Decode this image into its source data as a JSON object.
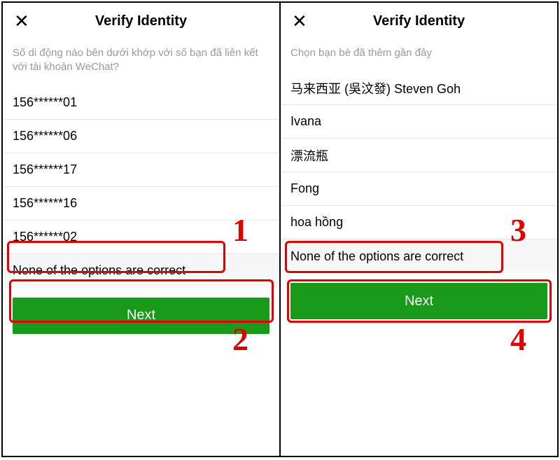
{
  "panels": [
    {
      "title": "Verify Identity",
      "close": "✕",
      "prompt": "Số di động nào bên dưới khớp với số bạn đã liên kết với tài khoản WeChat?",
      "options": [
        "156******01",
        "156******06",
        "156******17",
        "156******16",
        "156******02"
      ],
      "none_label": "None of the options are correct",
      "next_label": "Next",
      "annotations": {
        "none_num": "1",
        "next_num": "2"
      }
    },
    {
      "title": "Verify Identity",
      "close": "✕",
      "prompt": "Chọn bạn bè đã thêm gần đây",
      "options": [
        "马来西亚 (吳汶發) Steven Goh",
        "Ivana",
        "漂流瓶",
        "Fong",
        "hoa hồng"
      ],
      "none_label": "None of the options are correct",
      "next_label": "Next",
      "annotations": {
        "none_num": "3",
        "next_num": "4"
      }
    }
  ]
}
